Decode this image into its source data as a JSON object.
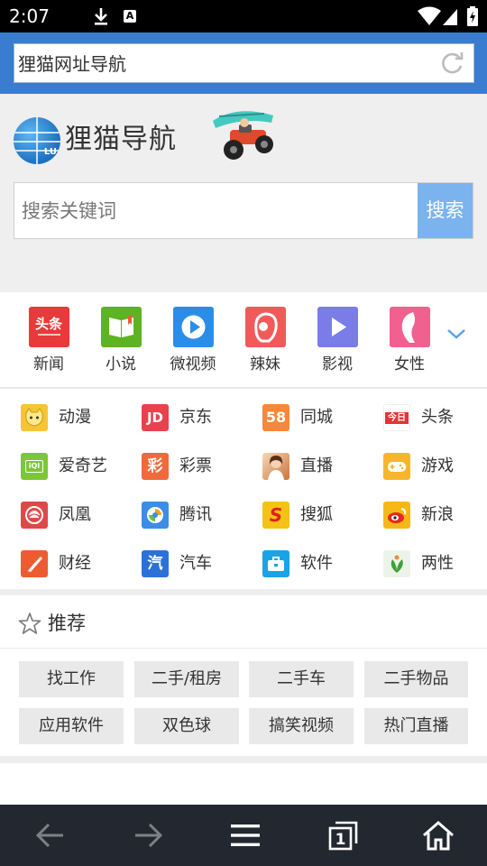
{
  "status_bar": {
    "time": "2:07",
    "notification_icons": [
      "download-icon",
      "a-box-icon"
    ],
    "system_icons": [
      "wifi-icon",
      "signal-icon",
      "battery-icon"
    ]
  },
  "address_bar": {
    "text": "狸猫网址导航",
    "refresh_icon": "refresh-icon"
  },
  "brand": {
    "name": "狸猫导航",
    "logo_letters": "LU"
  },
  "search": {
    "placeholder": "搜索关键词",
    "button_label": "搜索"
  },
  "quick_nav": {
    "items": [
      {
        "label": "新闻",
        "icon": "toutiao-icon",
        "color": "#e83a3a",
        "badge": "头条"
      },
      {
        "label": "小说",
        "icon": "book-icon",
        "color": "#5db322"
      },
      {
        "label": "微视频",
        "icon": "play-circle-icon",
        "color": "#2a8ee8"
      },
      {
        "label": "辣妹",
        "icon": "girl-icon",
        "color": "#f25a5a"
      },
      {
        "label": "影视",
        "icon": "play-triangle-icon",
        "color": "#7a7de8"
      },
      {
        "label": "女性",
        "icon": "woman-icon",
        "color": "#f1608f"
      }
    ],
    "more_icon": "chevron-down-icon"
  },
  "sites": [
    {
      "label": "动漫",
      "icon": "cat-icon",
      "color": "#f6c531"
    },
    {
      "label": "京东",
      "icon": "jd-icon",
      "color": "#e9414d",
      "badge": "JD"
    },
    {
      "label": "同城",
      "icon": "58-icon",
      "color": "#f5883b",
      "badge": "58"
    },
    {
      "label": "头条",
      "icon": "jinri-icon",
      "color": "#e53434",
      "badge": "今日"
    },
    {
      "label": "爱奇艺",
      "icon": "iqiyi-icon",
      "color": "#7cc63a",
      "badge": "iQI"
    },
    {
      "label": "彩票",
      "icon": "lottery-icon",
      "color": "#f06a3b",
      "badge": "彩"
    },
    {
      "label": "直播",
      "icon": "live-photo-icon",
      "color": "#e7a15b"
    },
    {
      "label": "游戏",
      "icon": "gamepad-icon",
      "color": "#f7b62a"
    },
    {
      "label": "凤凰",
      "icon": "phoenix-icon",
      "color": "#e04848"
    },
    {
      "label": "腾讯",
      "icon": "tencent-icon",
      "color": "#3d8de6"
    },
    {
      "label": "搜狐",
      "icon": "sohu-icon",
      "color": "#f4c316",
      "badge": "S"
    },
    {
      "label": "新浪",
      "icon": "weibo-icon",
      "color": "#f6b818"
    },
    {
      "label": "财经",
      "icon": "finance-icon",
      "color": "#ee5b30"
    },
    {
      "label": "汽车",
      "icon": "car-icon",
      "color": "#2c71d8",
      "badge": "汽"
    },
    {
      "label": "软件",
      "icon": "toolbox-icon",
      "color": "#1aa3e6"
    },
    {
      "label": "两性",
      "icon": "leaf-icon",
      "color": "#ecf4ea"
    }
  ],
  "recommend": {
    "title": "推荐",
    "tags": [
      "找工作",
      "二手/租房",
      "二手车",
      "二手物品",
      "应用软件",
      "双色球",
      "搞笑视频",
      "热门直播"
    ]
  },
  "toolbar": {
    "icons": [
      "back-arrow-icon",
      "forward-arrow-icon",
      "menu-icon",
      "tabs-icon",
      "home-icon"
    ],
    "tab_count": "1"
  },
  "colors": {
    "header_blue": "#3a7ccf",
    "search_button": "#7bb3ee",
    "toolbar_bg": "#222730"
  }
}
